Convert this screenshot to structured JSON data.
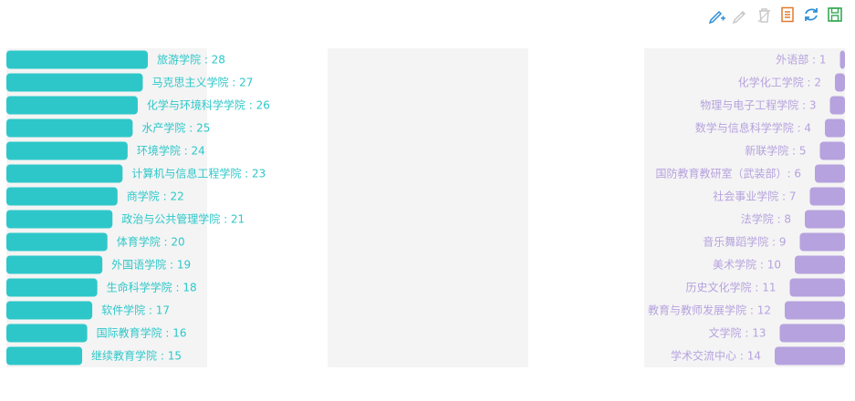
{
  "toolbar": {
    "icons": [
      "pencil-plus-icon",
      "pencil-icon",
      "trash-icon",
      "data-view-icon",
      "refresh-icon",
      "save-icon"
    ],
    "colors": [
      "#2f8fd8",
      "#c8c8c8",
      "#c8c8c8",
      "#e07b2c",
      "#2f8fd8",
      "#34a853"
    ]
  },
  "chart_data": [
    {
      "type": "bar",
      "orientation": "horizontal",
      "color": "#2ec7c9",
      "background": "#f4f4f4",
      "categories": [
        "旅游学院",
        "马克思主义学院",
        "化学与环境科学学院",
        "水产学院",
        "环境学院",
        "计算机与信息工程学院",
        "商学院",
        "政治与公共管理学院",
        "体育学院",
        "外国语学院",
        "生命科学学院",
        "软件学院",
        "国际教育学院",
        "继续教育学院"
      ],
      "values": [
        28,
        27,
        26,
        25,
        24,
        23,
        22,
        21,
        20,
        19,
        18,
        17,
        16,
        15
      ],
      "labels": [
        "旅游学院 : 28",
        "马克思主义学院 : 27",
        "化学与环境科学学院 : 26",
        "水产学院 : 25",
        "环境学院 : 24",
        "计算机与信息工程学院 : 23",
        "商学院 : 22",
        "政治与公共管理学院 : 21",
        "体育学院 : 20",
        "外国语学院 : 19",
        "生命科学学院 : 18",
        "软件学院 : 17",
        "国际教育学院 : 16",
        "继续教育学院 : 15"
      ]
    },
    {
      "type": "bar",
      "orientation": "horizontal",
      "color": "#b6a2de",
      "background": "#f4f4f4",
      "categories": [
        "外语部",
        "化学化工学院",
        "物理与电子工程学院",
        "数学与信息科学学院",
        "新联学院",
        "国防教育教研室（武装部）",
        "社会事业学院",
        "法学院",
        "音乐舞蹈学院",
        "美术学院",
        "历史文化学院",
        "教育与教师发展学院",
        "文学院",
        "学术交流中心"
      ],
      "values": [
        1,
        2,
        3,
        4,
        5,
        6,
        7,
        8,
        9,
        10,
        11,
        12,
        13,
        14
      ],
      "labels": [
        "外语部 : 1",
        "化学化工学院 : 2",
        "物理与电子工程学院 : 3",
        "数学与信息科学学院 : 4",
        "新联学院 : 5",
        "国防教育教研室（武装部）: 6",
        "社会事业学院 : 7",
        "法学院 : 8",
        "音乐舞蹈学院 : 9",
        "美术学院 : 10",
        "历史文化学院 : 11",
        "教育与教师发展学院 : 12",
        "文学院 : 13",
        "学术交流中心 : 14"
      ]
    }
  ]
}
